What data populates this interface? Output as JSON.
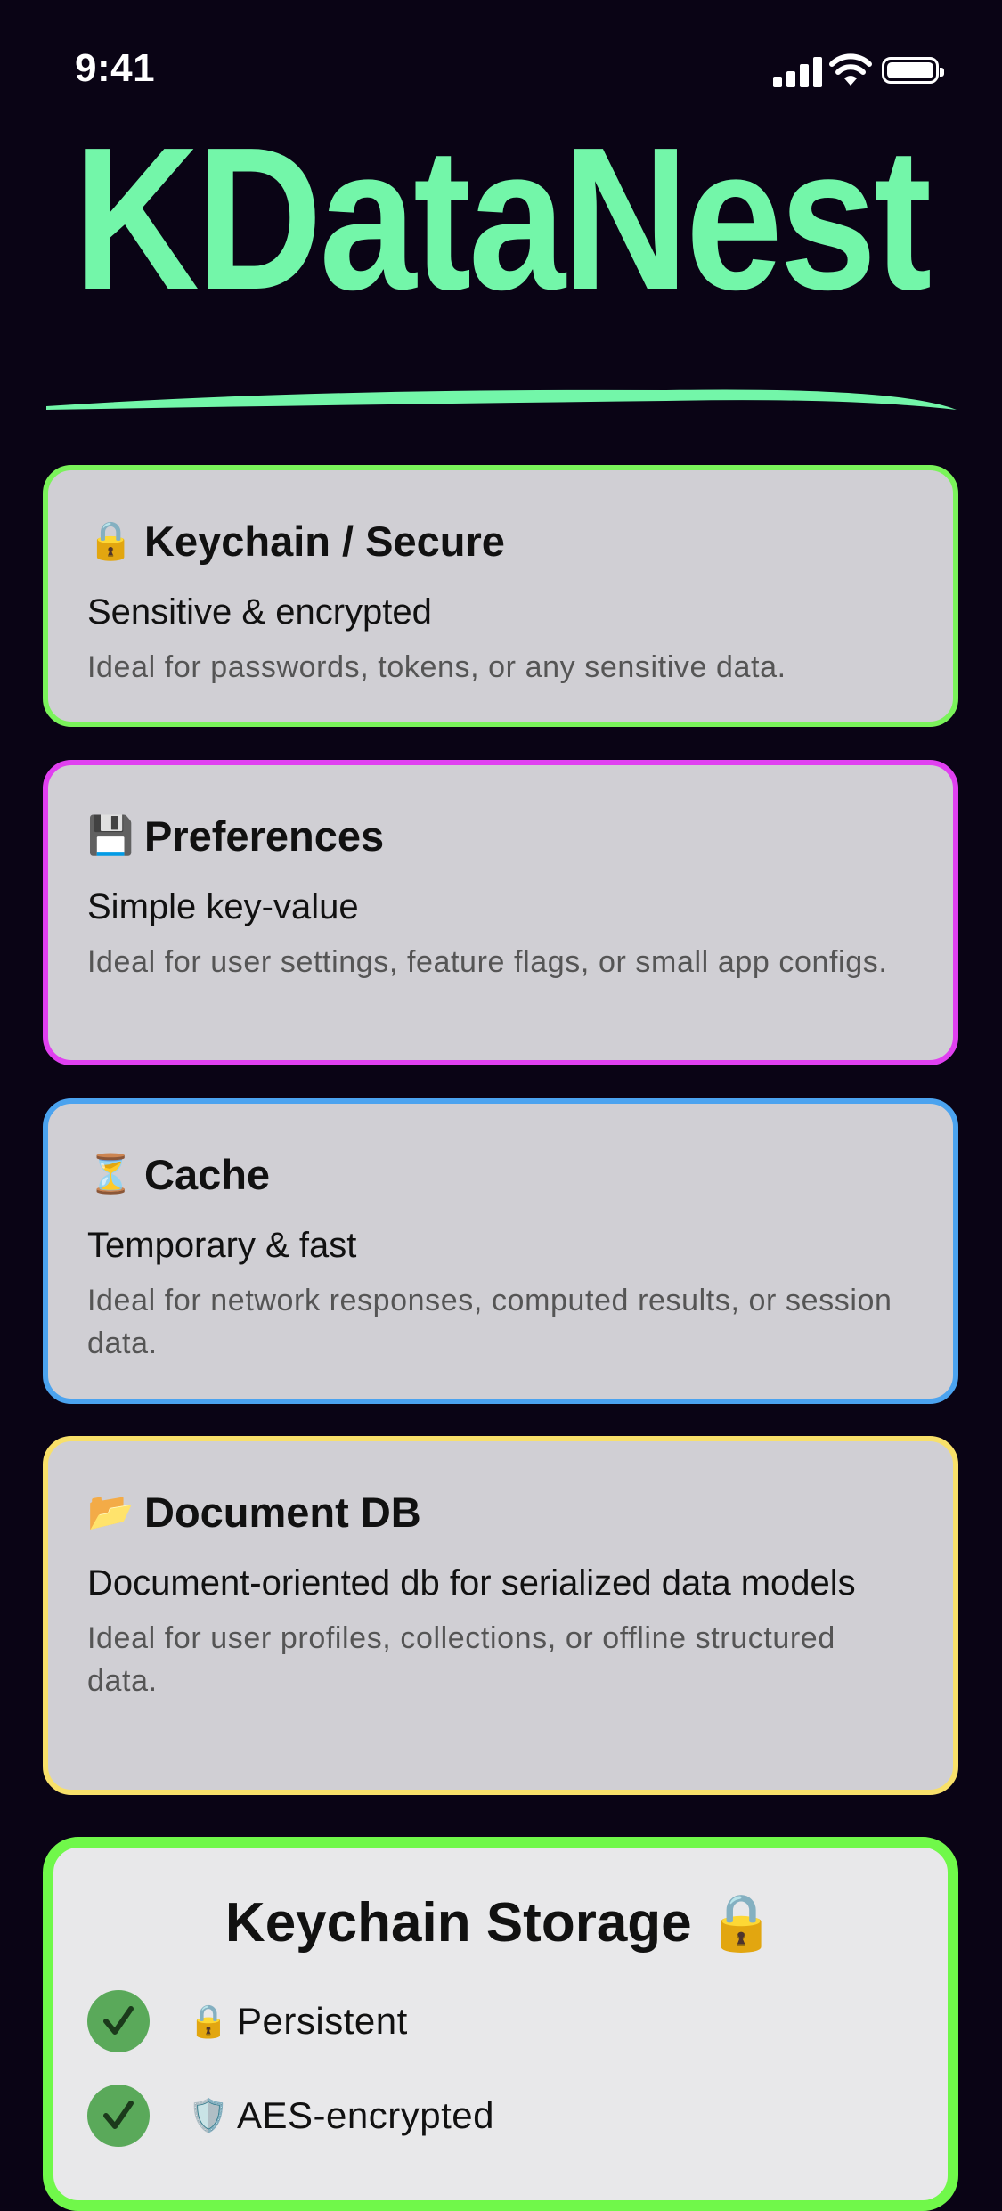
{
  "status_bar": {
    "time": "9:41"
  },
  "app": {
    "title": "KDataNest",
    "colors": {
      "background": "#0a0415",
      "accent": "#73f6a9"
    }
  },
  "cards": [
    {
      "emoji": "🔒",
      "icon_name": "lock-icon",
      "title": "Keychain / Secure",
      "subtitle": "Sensitive & encrypted",
      "description": "Ideal for passwords, tokens, or any sensitive data.",
      "border_color": "#7af35a"
    },
    {
      "emoji": "💾",
      "icon_name": "floppy-disk-icon",
      "title": "Preferences",
      "subtitle": "Simple key-value",
      "description": "Ideal for user settings, feature flags, or small app configs.",
      "border_color": "#e040f0"
    },
    {
      "emoji": "⏳",
      "icon_name": "hourglass-icon",
      "title": "Cache",
      "subtitle": "Temporary & fast",
      "description": "Ideal for network responses, computed results, or session data.",
      "border_color": "#4ba3ef"
    },
    {
      "emoji": "📂",
      "icon_name": "folder-icon",
      "title": "Document DB",
      "subtitle": "Document-oriented db for serialized data models",
      "description": "Ideal for user profiles, collections, or offline structured data.",
      "border_color": "#f8e06a"
    }
  ],
  "detail": {
    "title": "Keychain Storage 🔒",
    "border_color": "#70f84a",
    "features": [
      {
        "emoji": "🔒",
        "icon_name": "lock-icon",
        "label": "Persistent"
      },
      {
        "emoji": "🛡️",
        "icon_name": "shield-icon",
        "label": "AES-encrypted"
      }
    ]
  }
}
